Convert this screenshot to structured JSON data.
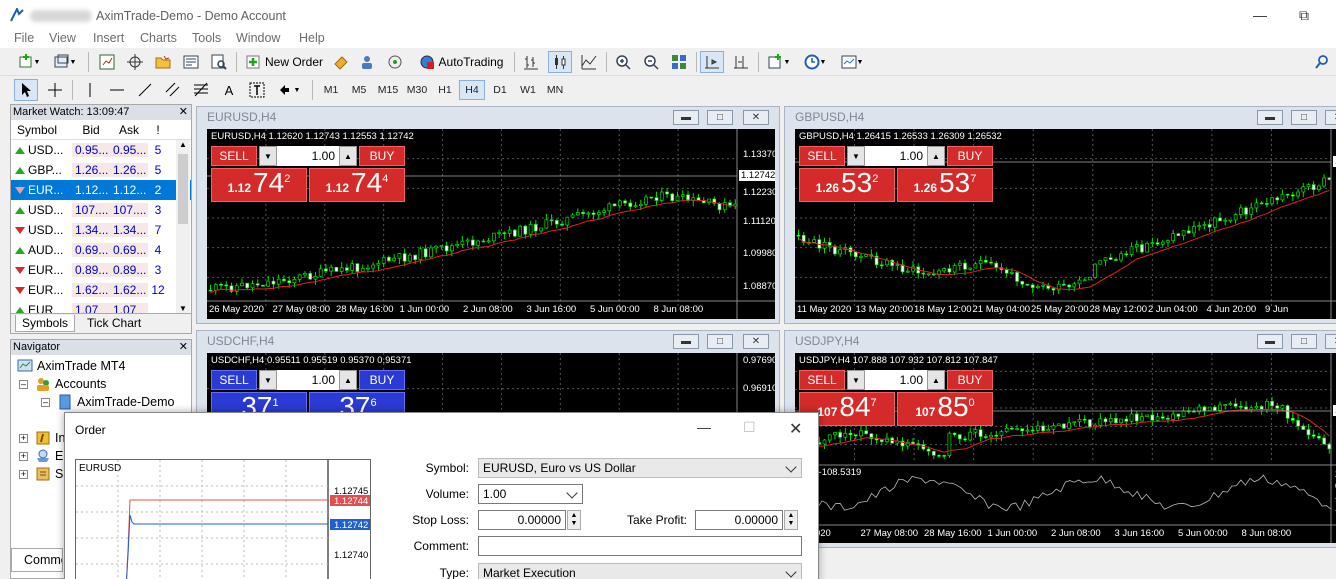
{
  "window": {
    "title": "AximTrade-Demo - Demo Account"
  },
  "menu": [
    "File",
    "View",
    "Insert",
    "Charts",
    "Tools",
    "Window",
    "Help"
  ],
  "toolbar": {
    "new_order": "New Order",
    "autotrading": "AutoTrading"
  },
  "timeframes": [
    "M1",
    "M5",
    "M15",
    "M30",
    "H1",
    "H4",
    "D1",
    "W1",
    "MN"
  ],
  "timeframe_active": "H4",
  "drawing_tools": {
    "text": "A"
  },
  "market_watch": {
    "title": "Market Watch: 13:09:47",
    "headers": {
      "symbol": "Symbol",
      "bid": "Bid",
      "ask": "Ask",
      "spread": "!"
    },
    "rows": [
      {
        "symbol": "USD...",
        "bid": "0.95...",
        "ask": "0.95...",
        "spread": "5",
        "dir": "up"
      },
      {
        "symbol": "GBP...",
        "bid": "1.26...",
        "ask": "1.26...",
        "spread": "5",
        "dir": "up"
      },
      {
        "symbol": "EUR...",
        "bid": "1.12...",
        "ask": "1.12...",
        "spread": "2",
        "dir": "down"
      },
      {
        "symbol": "USD...",
        "bid": "107....",
        "ask": "107....",
        "spread": "3",
        "dir": "up"
      },
      {
        "symbol": "USD...",
        "bid": "1.34...",
        "ask": "1.34...",
        "spread": "7",
        "dir": "down"
      },
      {
        "symbol": "AUD...",
        "bid": "0.69...",
        "ask": "0.69...",
        "spread": "4",
        "dir": "up"
      },
      {
        "symbol": "EUR...",
        "bid": "0.89...",
        "ask": "0.89...",
        "spread": "3",
        "dir": "down"
      },
      {
        "symbol": "EUR...",
        "bid": "1.62...",
        "ask": "1.62...",
        "spread": "12",
        "dir": "down"
      },
      {
        "symbol": "EUR",
        "bid": "1.07",
        "ask": "1.07",
        "spread": "",
        "dir": "up"
      }
    ],
    "selected_index": 2,
    "tabs": [
      "Symbols",
      "Tick Chart"
    ]
  },
  "navigator": {
    "title": "Navigator",
    "root": "AximTrade MT4",
    "accounts": "Accounts",
    "account": "AximTrade-Demo",
    "items_partial": [
      "In",
      "E",
      "S"
    ],
    "bottom_tab_partial": "Commo"
  },
  "charts": [
    {
      "id": "eurusd",
      "window_title": "EURUSD,H4",
      "ohlc": "EURUSD,H4  1.12620 1.12743 1.12553 1.12742",
      "lot": "1.00",
      "sell_label": "SELL",
      "buy_label": "BUY",
      "sell_price": {
        "prefix": "1.12",
        "big": "74",
        "sup": "2"
      },
      "buy_price": {
        "prefix": "1.12",
        "big": "74",
        "sup": "4"
      },
      "panel_color": "red",
      "y_ticks": [
        "1.13370",
        "1.12230",
        "1.11120",
        "1.09980",
        "1.08870"
      ],
      "current_price": "1.12742",
      "x_ticks": [
        "26 May 2020",
        "27 May 08:00",
        "28 May 16:00",
        "1 Jun 00:00",
        "2 Jun 08:00",
        "3 Jun 16:00",
        "5 Jun 00:00",
        "8 Jun 08:00"
      ]
    },
    {
      "id": "gbpusd",
      "window_title": "GBPUSD,H4",
      "ohlc": "GBPUSD,H4  1.26415 1.26533 1.26309 1.26532",
      "lot": "1.00",
      "sell_label": "SELL",
      "buy_label": "BUY",
      "sell_price": {
        "prefix": "1.26",
        "big": "53",
        "sup": "2"
      },
      "buy_price": {
        "prefix": "1.26",
        "big": "53",
        "sup": "7"
      },
      "panel_color": "red",
      "y_ticks": [
        "1.2",
        "1.2",
        "1.2",
        "1.2",
        "1.2"
      ],
      "current_price": "1.2",
      "x_ticks": [
        "11 May 2020",
        "13 May 20:00",
        "18 May 12:00",
        "21 May 04:00",
        "25 May 20:00",
        "28 May 12:00",
        "2 Jun 04:00",
        "4 Jun 20:00",
        "9 Jun"
      ]
    },
    {
      "id": "usdchf",
      "window_title": "USDCHF,H4",
      "ohlc": "USDCHF,H4  0.95511 0.95519 0.95370 0.95371",
      "lot": "1.00",
      "sell_label": "SELL",
      "buy_label": "BUY",
      "sell_price": {
        "prefix": "",
        "big": "37",
        "sup": "1"
      },
      "buy_price": {
        "prefix": "",
        "big": "37",
        "sup": "6"
      },
      "panel_color": "blue",
      "y_ticks": [
        "0.97690",
        "0.96910"
      ],
      "current_price": "",
      "x_ticks": []
    },
    {
      "id": "usdjpy",
      "window_title": "USDJPY,H4",
      "ohlc": "USDJPY,H4  107.888 107.932 107.812 107.847",
      "lot": "1.00",
      "sell_label": "SELL",
      "buy_label": "BUY",
      "sell_price": {
        "prefix": "107",
        "big": "84",
        "sup": "7"
      },
      "buy_price": {
        "prefix": "107",
        "big": "85",
        "sup": "0"
      },
      "panel_color": "red",
      "y_ticks": [
        "10",
        "10",
        "10"
      ],
      "current_price": "10",
      "indicator_label": "(14) -108.5319",
      "indicator_ticks": [
        "291",
        "0.0",
        "-100",
        "-15"
      ],
      "x_ticks": [
        "ay 2020",
        "27 May 08:00",
        "28 May 16:00",
        "1 Jun 00:00",
        "2 Jun 08:00",
        "3 Jun 16:00",
        "5 Jun 00:00",
        "8 Jun 08:00"
      ]
    }
  ],
  "order": {
    "title": "Order",
    "chart_symbol": "EURUSD",
    "chart_ticks": [
      "1.12745",
      "1.12744",
      "1.12742",
      "1.12740"
    ],
    "fields": {
      "symbol_label": "Symbol:",
      "symbol_value": "EURUSD, Euro vs US Dollar",
      "volume_label": "Volume:",
      "volume_value": "1.00",
      "stoploss_label": "Stop Loss:",
      "stoploss_value": "0.00000",
      "takeprofit_label": "Take Profit:",
      "takeprofit_value": "0.00000",
      "comment_label": "Comment:",
      "comment_value": "",
      "type_label": "Type:",
      "type_value": "Market Execution"
    }
  },
  "colors": {
    "bull": "#00e000",
    "bear": "#ffffff",
    "ma": "#e02020",
    "panel_bg": "#dde3ec",
    "selection": "#0078d7"
  }
}
